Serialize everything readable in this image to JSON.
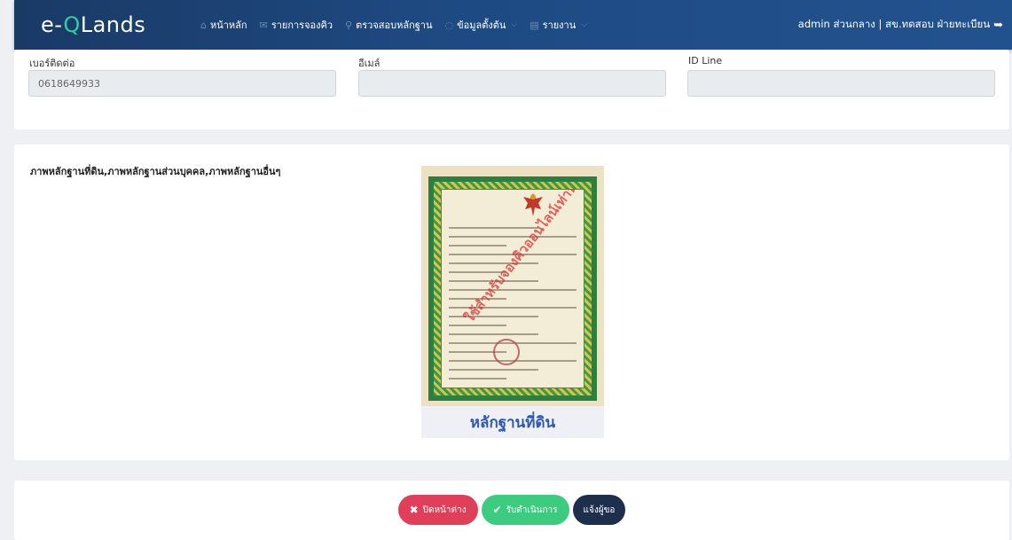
{
  "app": {
    "brand_prefix": "e-",
    "brand_q": "Q",
    "brand_suffix": "Lands"
  },
  "nav": {
    "items": [
      {
        "icon": "home-icon",
        "label": "หน้าหลัก"
      },
      {
        "icon": "envelope-icon",
        "label": "รายการจองคิว"
      },
      {
        "icon": "search-icon",
        "label": "ตรวจสอบหลักฐาน"
      },
      {
        "icon": "database-icon",
        "label": "ข้อมูลตั้งต้น"
      },
      {
        "icon": "document-icon",
        "label": "รายงาน"
      }
    ],
    "user": "admin ส่วนกลาง | สข.ทดสอบ ฝ่ายทะเบียน"
  },
  "contact": {
    "phone_label": "เบอร์ติดต่อ",
    "phone_value": "0618649933",
    "email_label": "อีเมล์",
    "email_value": "",
    "line_label": "ID Line",
    "line_value": ""
  },
  "evidence": {
    "title": "ภาพหลักฐานที่ดิน,ภาพหลักฐานส่วนบุคคล,ภาพหลักฐานอื่นๆ",
    "image_caption": "หลักฐานที่ดิน",
    "watermark": "ใช้สำหรับจองคิวออนไลน์เท่านั้น"
  },
  "actions": {
    "close_label": "ปิดหน้าต่าง",
    "accept_label": "รับดำเนินการ",
    "notify_label": "แจ้งผู้ขอ"
  },
  "colors": {
    "navbar": "#1e4a83",
    "brand_accent": "#2ed0a5",
    "close": "#e03f5a",
    "accept": "#3ccb7f",
    "notify": "#1d2f4c"
  }
}
